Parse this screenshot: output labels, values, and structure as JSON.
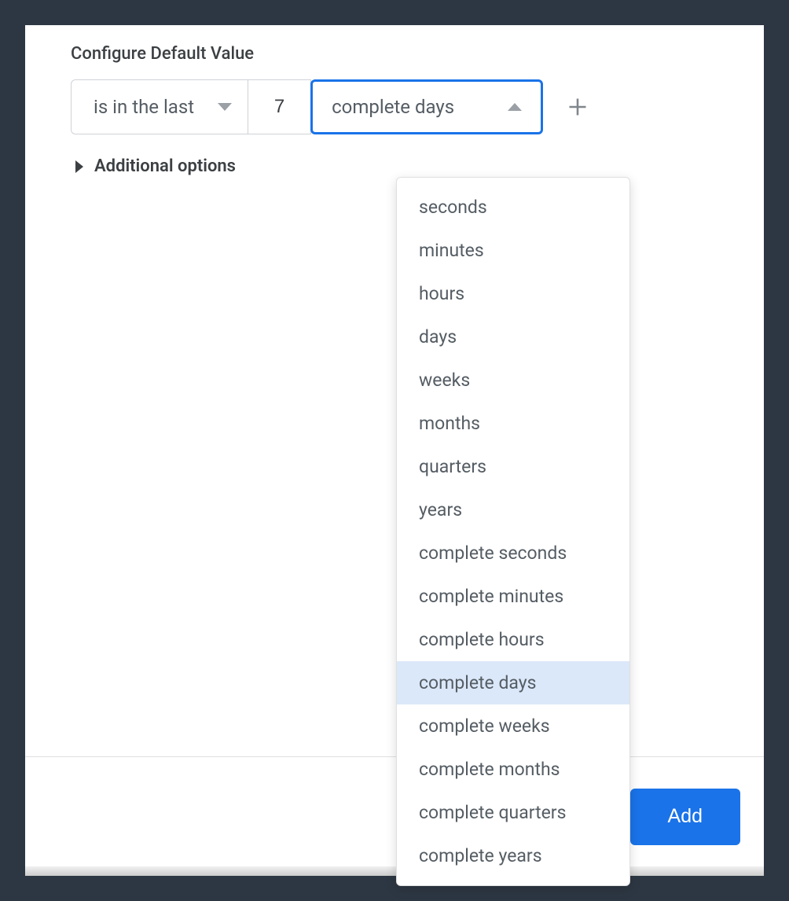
{
  "section": {
    "title": "Configure Default Value"
  },
  "filter": {
    "operator_label": "is in the last",
    "value": "7",
    "unit_label": "complete days"
  },
  "additional": {
    "label": "Additional options"
  },
  "unit_options": [
    "seconds",
    "minutes",
    "hours",
    "days",
    "weeks",
    "months",
    "quarters",
    "years",
    "complete seconds",
    "complete minutes",
    "complete hours",
    "complete days",
    "complete weeks",
    "complete months",
    "complete quarters",
    "complete years"
  ],
  "unit_selected_index": 11,
  "footer": {
    "add_label": "Add"
  }
}
